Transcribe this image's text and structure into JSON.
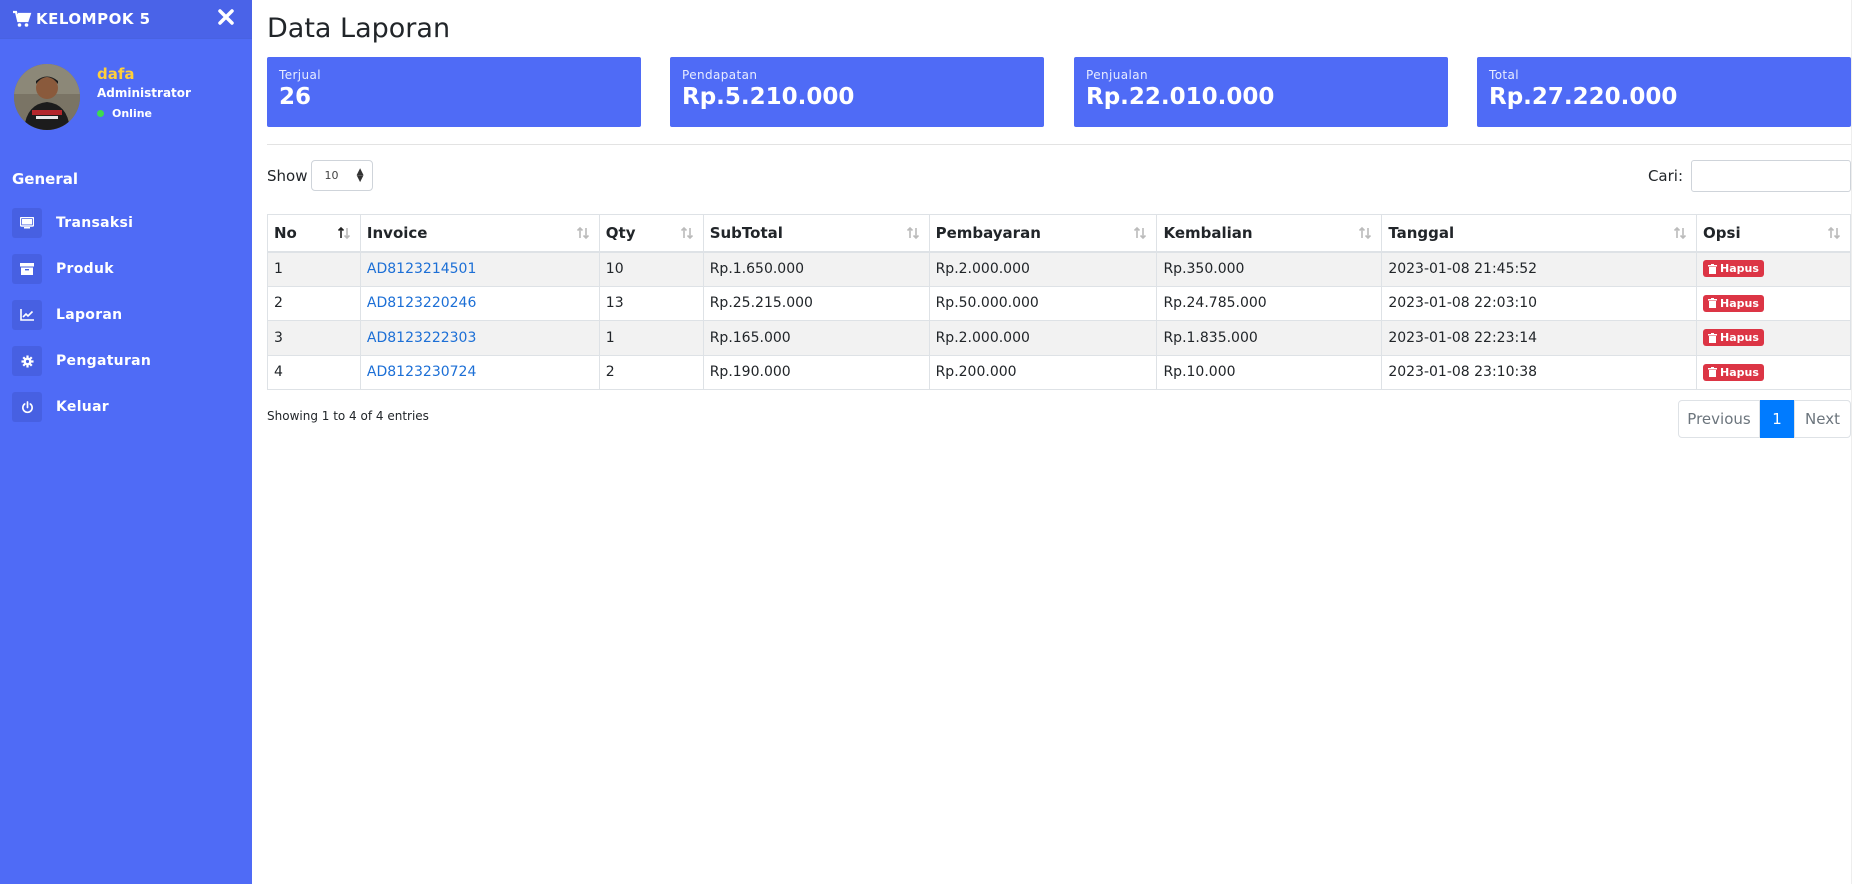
{
  "app": {
    "brand": "KELOMPOK 5"
  },
  "profile": {
    "name": "dafa",
    "role": "Administrator",
    "status": "Online"
  },
  "sidebar": {
    "header": "General",
    "items": [
      {
        "label": "Transaksi",
        "icon": "monitor-icon"
      },
      {
        "label": "Produk",
        "icon": "archive-icon"
      },
      {
        "label": "Laporan",
        "icon": "chart-line-icon"
      },
      {
        "label": "Pengaturan",
        "icon": "gear-icon"
      },
      {
        "label": "Keluar",
        "icon": "power-icon"
      }
    ]
  },
  "page": {
    "title": "Data Laporan"
  },
  "cards": [
    {
      "label": "Terjual",
      "value": "26"
    },
    {
      "label": "Pendapatan",
      "value": "Rp.5.210.000"
    },
    {
      "label": "Penjualan",
      "value": "Rp.22.010.000"
    },
    {
      "label": "Total",
      "value": "Rp.27.220.000"
    }
  ],
  "table_controls": {
    "show_label": "Show",
    "show_value": "10",
    "search_label": "Cari:",
    "search_value": ""
  },
  "table": {
    "columns": [
      "No",
      "Invoice",
      "Qty",
      "SubTotal",
      "Pembayaran",
      "Kembalian",
      "Tanggal",
      "Opsi"
    ],
    "rows": [
      {
        "no": "1",
        "invoice": "AD8123214501",
        "qty": "10",
        "subtotal": "Rp.1.650.000",
        "pembayaran": "Rp.2.000.000",
        "kembalian": "Rp.350.000",
        "tanggal": "2023-01-08 21:45:52",
        "action": "Hapus"
      },
      {
        "no": "2",
        "invoice": "AD8123220246",
        "qty": "13",
        "subtotal": "Rp.25.215.000",
        "pembayaran": "Rp.50.000.000",
        "kembalian": "Rp.24.785.000",
        "tanggal": "2023-01-08 22:03:10",
        "action": "Hapus"
      },
      {
        "no": "3",
        "invoice": "AD8123222303",
        "qty": "1",
        "subtotal": "Rp.165.000",
        "pembayaran": "Rp.2.000.000",
        "kembalian": "Rp.1.835.000",
        "tanggal": "2023-01-08 22:23:14",
        "action": "Hapus"
      },
      {
        "no": "4",
        "invoice": "AD8123230724",
        "qty": "2",
        "subtotal": "Rp.190.000",
        "pembayaran": "Rp.200.000",
        "kembalian": "Rp.10.000",
        "tanggal": "2023-01-08 23:10:38",
        "action": "Hapus"
      }
    ],
    "info": "Showing 1 to 4 of 4 entries"
  },
  "pagination": {
    "previous": "Previous",
    "current": "1",
    "next": "Next"
  },
  "colors": {
    "sidebar": "#4f6bf6",
    "card": "#4f6bf6",
    "danger": "#dc3545",
    "link": "#1c6fd6",
    "active_page": "#007bff",
    "username": "#ffcf3a"
  }
}
